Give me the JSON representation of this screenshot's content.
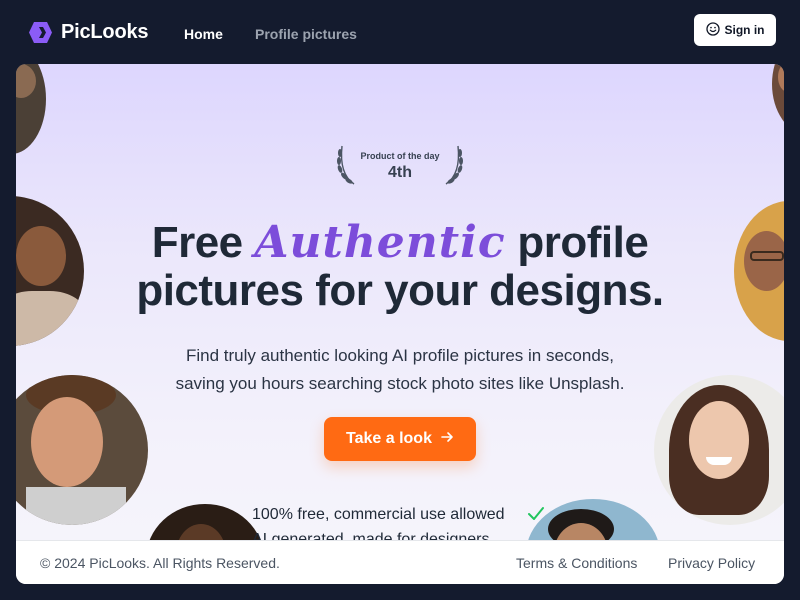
{
  "brand": {
    "name": "PicLooks",
    "logo_icon": "hexagon-logo-icon",
    "accent": "#8b5cf6"
  },
  "nav": {
    "links": [
      {
        "label": "Home"
      },
      {
        "label": "Profile pictures"
      }
    ],
    "signin": {
      "label": "Sign in",
      "icon": "smiley-icon"
    }
  },
  "hero": {
    "badge": {
      "label": "Product of the day",
      "rank": "4th",
      "icon": "laurel-icon"
    },
    "headline": {
      "prefix": "Free ",
      "accent": "Authentic",
      "suffix_line1": " profile",
      "line2": "pictures for your designs."
    },
    "accent_color": "#7c4dda",
    "subtitle_line1": "Find truly authentic looking AI profile pictures in seconds,",
    "subtitle_line2": "saving you hours searching stock photo sites like Unsplash.",
    "cta": {
      "label": "Take a look",
      "icon": "arrow-right-icon",
      "color": "#ff6a13"
    },
    "features": [
      {
        "label": "100% free, commercial use allowed",
        "icon": "check-icon",
        "color": "#22c55e"
      },
      {
        "label": "AI generated, made for designers"
      }
    ]
  },
  "footer": {
    "copyright": "© 2024 PicLooks. All Rights Reserved.",
    "links": [
      {
        "label": "Terms & Conditions"
      },
      {
        "label": "Privacy Policy"
      }
    ]
  }
}
